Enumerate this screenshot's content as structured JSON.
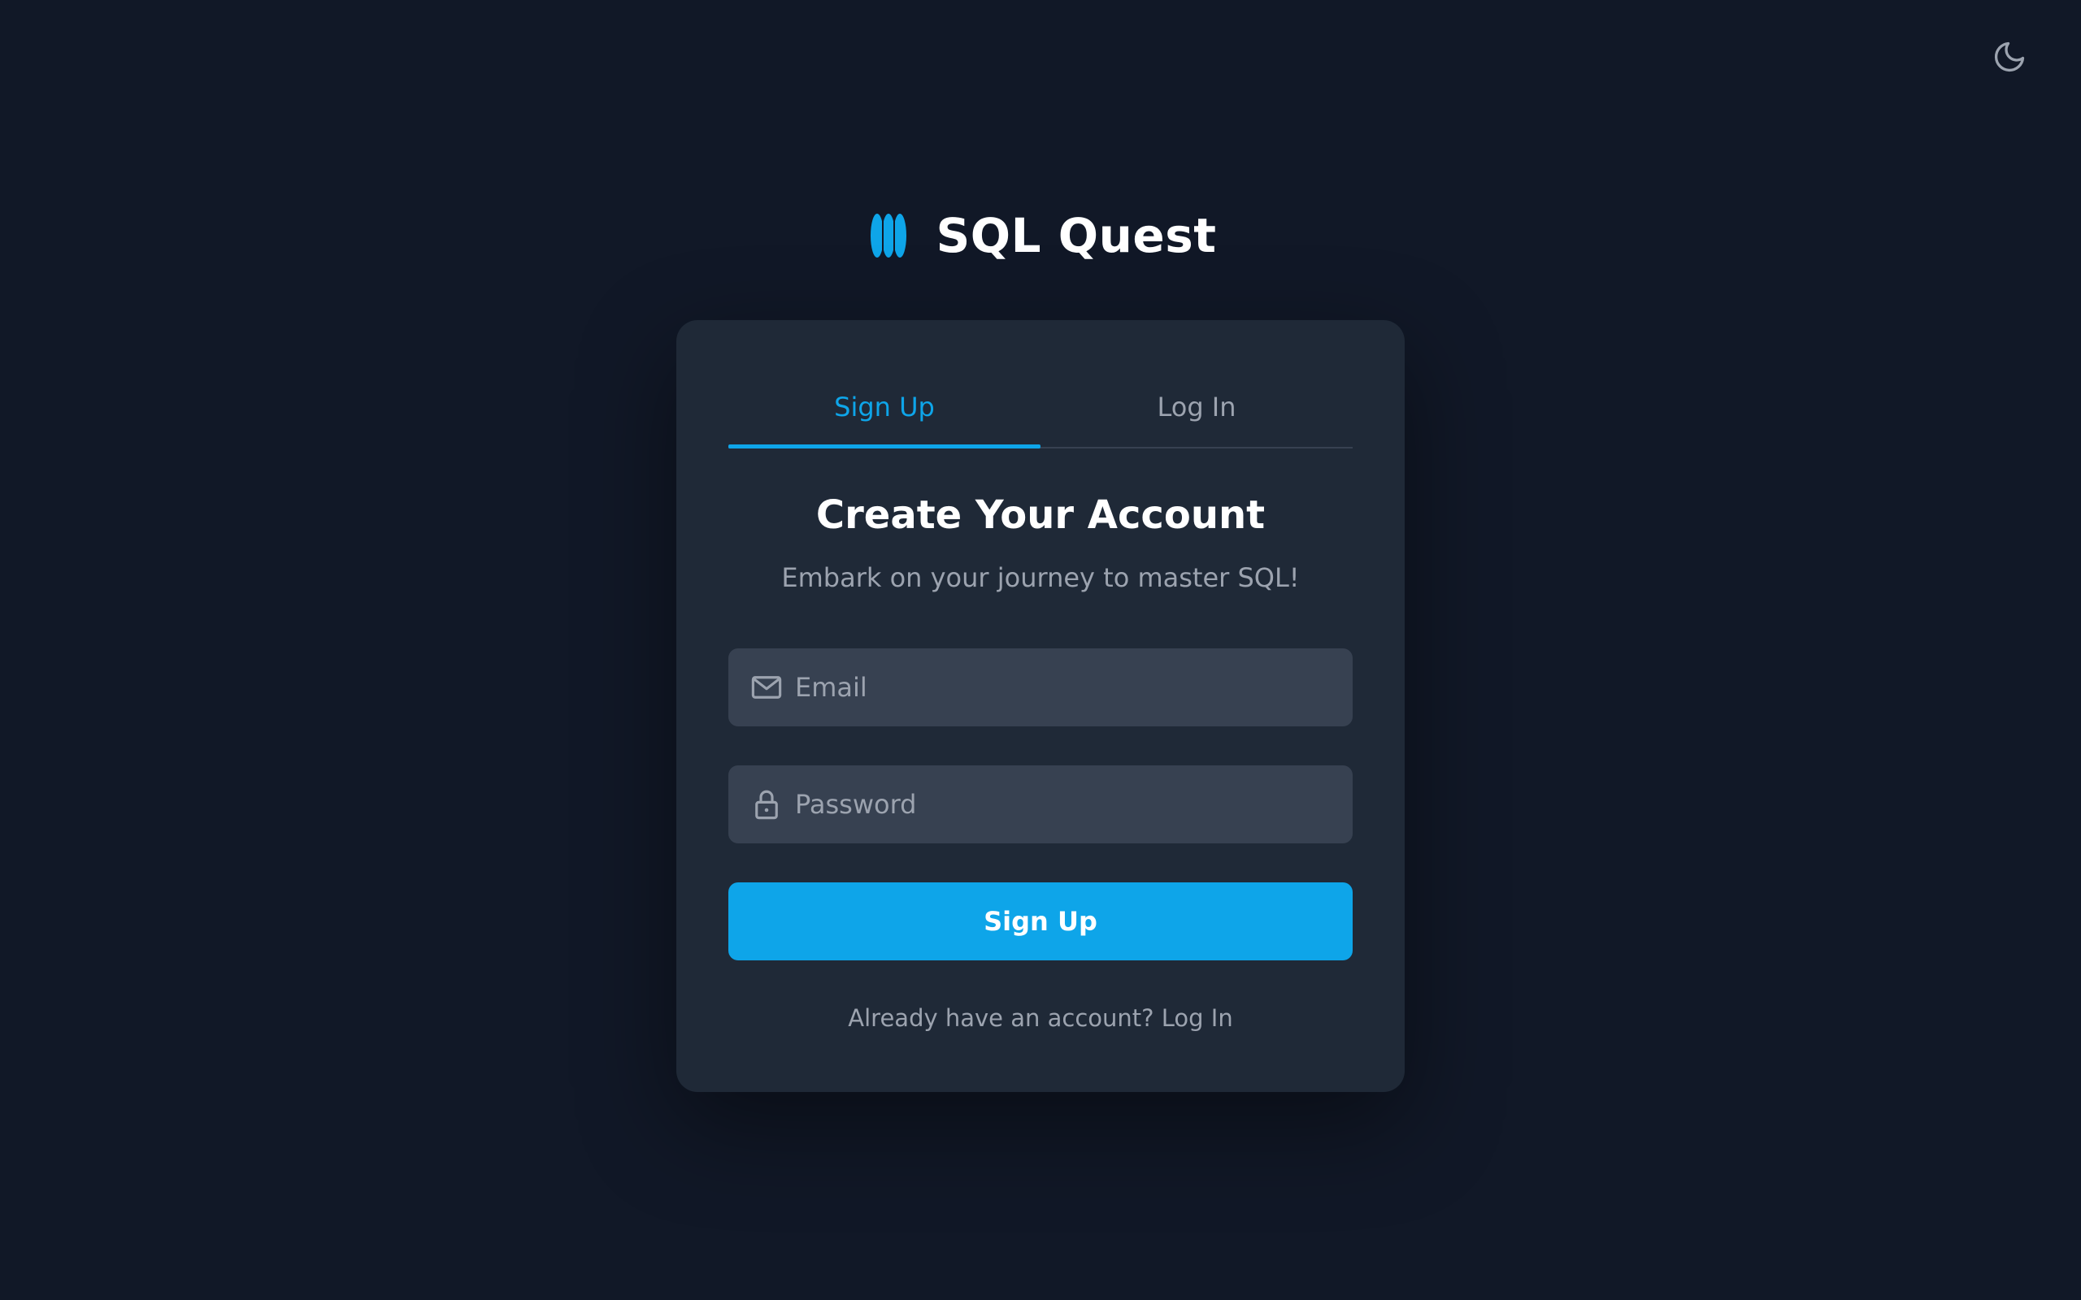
{
  "app": {
    "name": "SQL Quest"
  },
  "theme_toggle": {
    "icon": "moon-icon"
  },
  "tabs": [
    {
      "label": "Sign Up",
      "active": true
    },
    {
      "label": "Log In",
      "active": false
    }
  ],
  "form": {
    "title": "Create Your Account",
    "subtitle": "Embark on your journey to master SQL!",
    "email": {
      "value": "",
      "placeholder": "Email",
      "icon": "mail-icon"
    },
    "password": {
      "value": "",
      "placeholder": "Password",
      "icon": "lock-icon"
    },
    "submit_label": "Sign Up",
    "footer_text": "Already have an account?",
    "footer_link": "Log In"
  },
  "colors": {
    "background": "#111827",
    "card": "#1f2937",
    "input": "#374151",
    "accent": "#0ea5e9",
    "muted_text": "#9ca3af"
  }
}
